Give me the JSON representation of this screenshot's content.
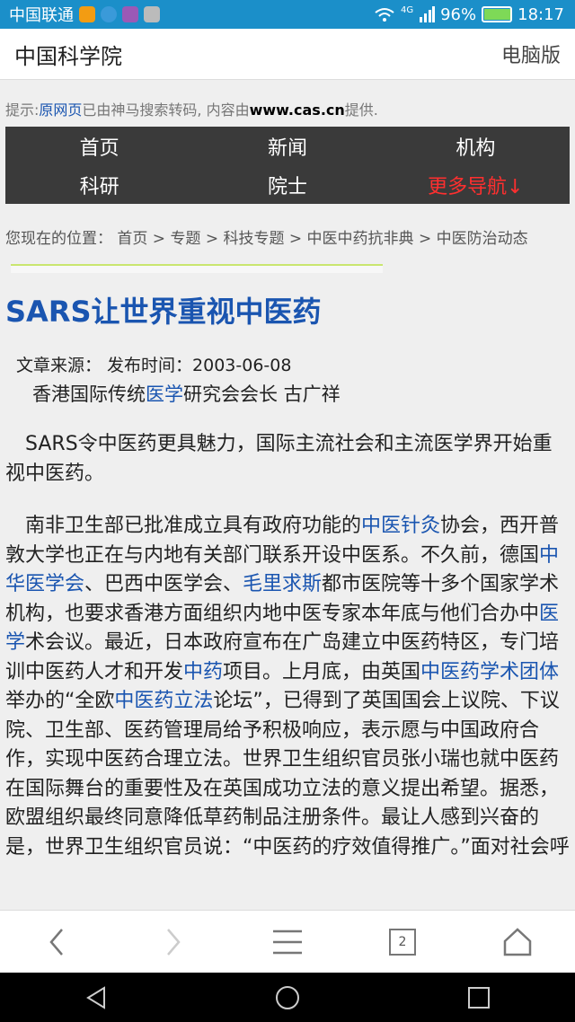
{
  "status_bar": {
    "carrier": "中国联通",
    "network": "4G",
    "battery": "96%",
    "battery_level": 0.96,
    "time": "18:17"
  },
  "header": {
    "title": "中国科学院",
    "pc_version": "电脑版"
  },
  "tip": {
    "prefix": "提示:",
    "link": "原网页",
    "middle": "已由神马搜索转码, 内容由",
    "domain": "www.cas.cn",
    "suffix": "提供."
  },
  "nav": {
    "items": [
      "首页",
      "新闻",
      "机构",
      "科研",
      "院士"
    ],
    "more": "更多导航↓"
  },
  "breadcrumb": {
    "text": "您现在的位置：  首页 > 专题 > 科技专题 > 中医中药抗非典 > 中医防治动态"
  },
  "article": {
    "title_part1": "SARS让世界重视",
    "title_part2": "中医药",
    "meta": "文章来源：   发布时间：2003-06-08",
    "author_prefix": "香港国际传统",
    "author_link": "医学",
    "author_suffix": "研究会会长 古广祥",
    "para1": "SARS令中医药更具魅力，国际主流社会和主流医学界开始重视中医药。",
    "para2": [
      {
        "t": "南非卫生部已批准成立具有政府功能的"
      },
      {
        "t": "中医针灸",
        "link": true
      },
      {
        "t": "协会，西开普敦大学也正在与内地有关部门联系开设中医系。不久前，德国"
      },
      {
        "t": "中华医学会",
        "link": true
      },
      {
        "t": "、巴西中医学会、"
      },
      {
        "t": "毛里求斯",
        "link": true
      },
      {
        "t": "都市医院等十多个国家学术机构，也要求香港方面组织内地中医专家本年底与他们合办中"
      },
      {
        "t": "医学",
        "link": true
      },
      {
        "t": "术会议。最近，日本政府宣布在广岛建立中医药特区，专门培训中医药人才和开发"
      },
      {
        "t": "中药",
        "link": true
      },
      {
        "t": "项目。上月底，由英国"
      },
      {
        "t": "中医药学术团体",
        "link": true
      },
      {
        "t": "举办的“全欧"
      },
      {
        "t": "中医药立法",
        "link": true
      },
      {
        "t": "论坛”，已得到了英国国会上议院、下议院、卫生部、医药管理局给予积极响应，表示愿与中国政府合作，实现中医药合理立法。世界卫生组织官员张小瑞也就中医药在国际舞台的重要性及在英国成功立法的意义提出希望。据悉，欧盟组织最终同意降低草药制品注册条件。最让人感到兴奋的是，世界卫生组织官员说：“中医药的疗效值得推广。”面对社会呼"
      }
    ]
  },
  "toolbar": {
    "tab_count": "2"
  }
}
